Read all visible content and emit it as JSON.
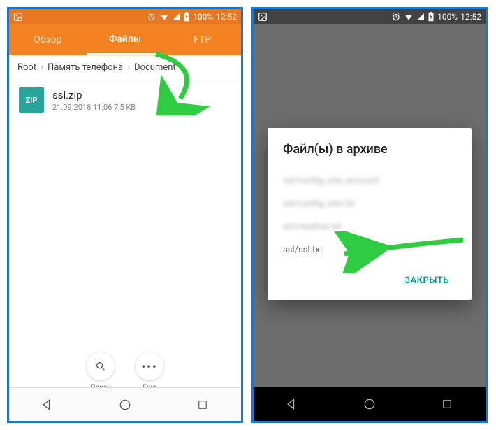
{
  "status": {
    "battery": "100%",
    "time": "12:52"
  },
  "tabs": {
    "overview": "Обзор",
    "files": "Файлы",
    "ftp": "FTP"
  },
  "breadcrumb": {
    "root": "Root",
    "storage": "Память телефона",
    "folder": "Document"
  },
  "file": {
    "icon_label": "ZIP",
    "name": "ssl.zip",
    "meta": "21.09.2018 11:06  7,5 KB"
  },
  "bottom": {
    "search": "Поиск",
    "more": "Еще"
  },
  "dialog": {
    "title": "Файл(ы) в архиве",
    "item_blur1": "ssl/config_site_account",
    "item_blur2": "ssl/config_site.txt",
    "item_blur3": "ssl/readme.txt",
    "item_clear": "ssl/ssl.txt",
    "close": "ЗАКРЫТЬ"
  }
}
